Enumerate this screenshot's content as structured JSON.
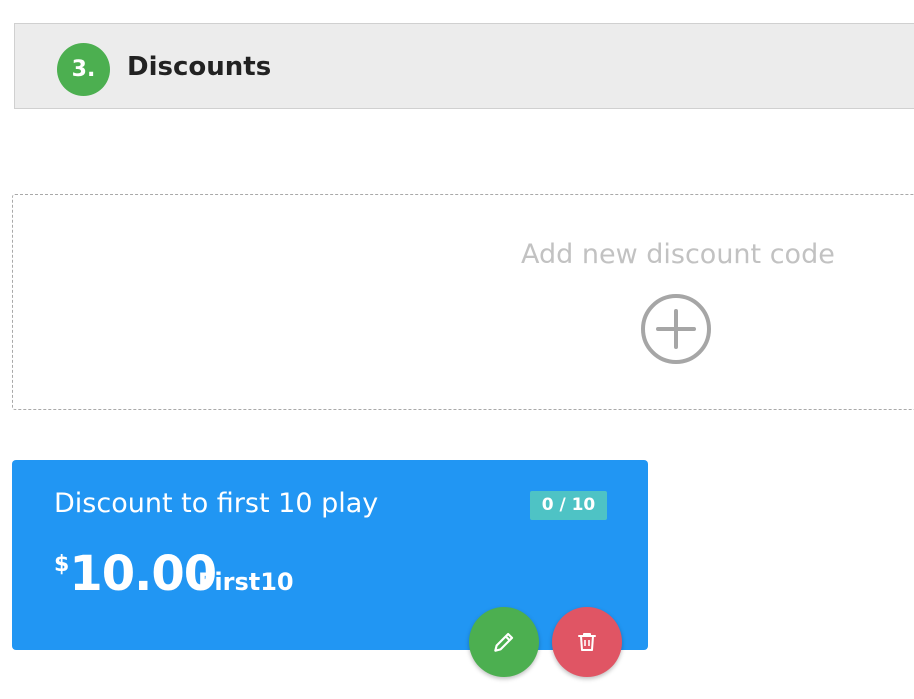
{
  "section": {
    "step_number": "3.",
    "title": "Discounts"
  },
  "add_discount": {
    "label": "Add new discount code",
    "icon": "plus-circle-icon"
  },
  "discount_cards": [
    {
      "title": "Discount to first 10 play",
      "usage": "0 / 10",
      "currency_symbol": "$",
      "amount": "10.00",
      "code": "First10",
      "actions": {
        "edit_icon": "pencil-icon",
        "delete_icon": "trash-icon"
      }
    }
  ],
  "colors": {
    "step_badge": "#4caf50",
    "card_background": "#2196f3",
    "usage_badge": "#4ec3c5",
    "edit_button": "#4caf50",
    "delete_button": "#e05564",
    "add_label": "#c2c2c2",
    "add_icon": "#a6a6a6"
  }
}
